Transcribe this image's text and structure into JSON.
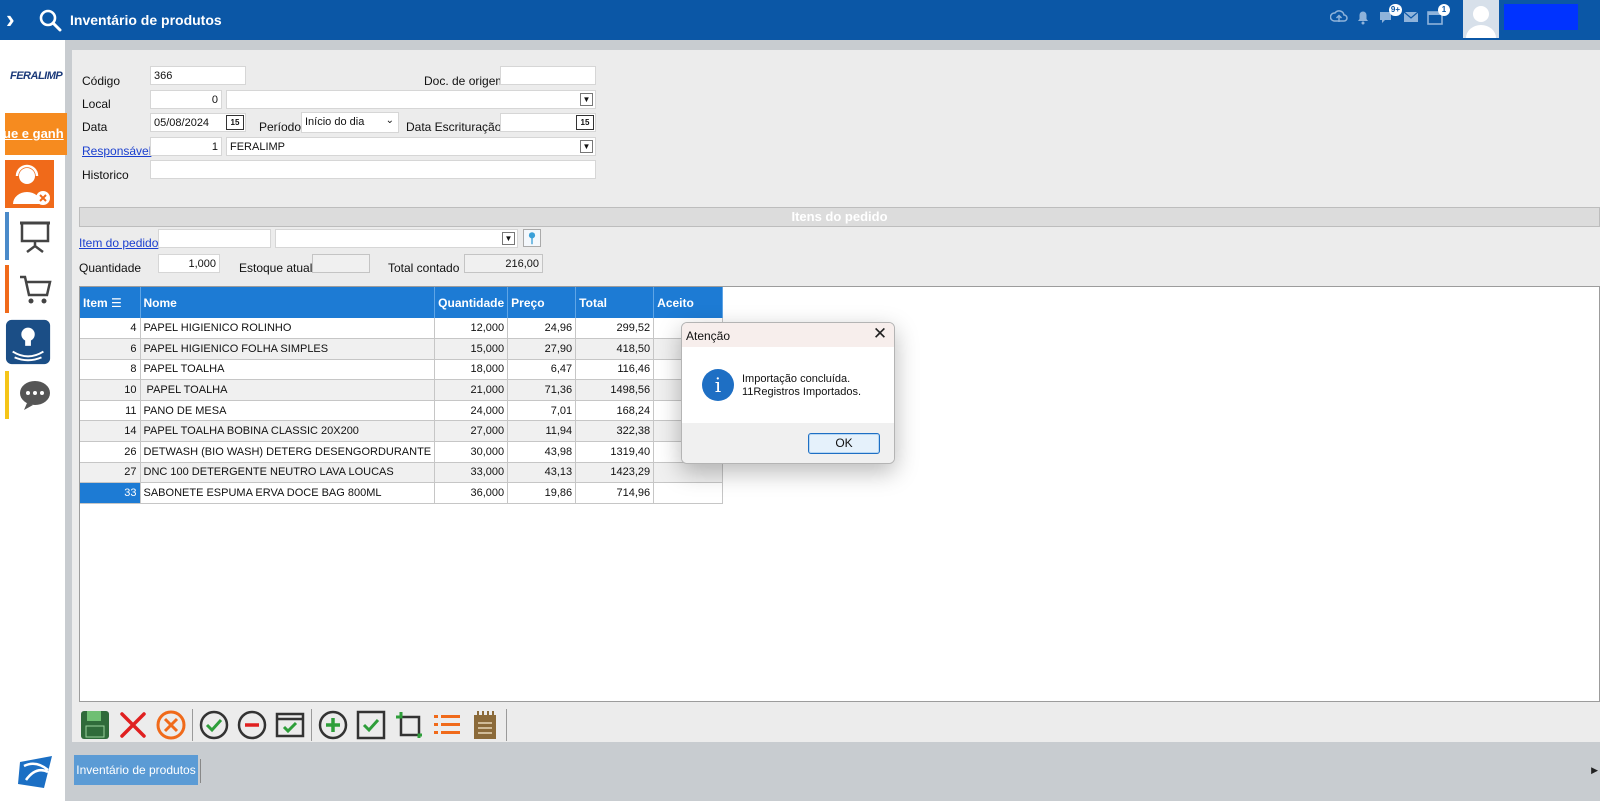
{
  "window": {
    "title": "Inventário de produtos"
  },
  "topbar": {
    "notifications_badge": "9+",
    "calendar_badge": "1"
  },
  "sidebar": {
    "logo_text": "FERALIMP",
    "promo_text": "ue e ganh"
  },
  "form": {
    "codigo": {
      "label": "Código",
      "value": "366"
    },
    "doc_origem": {
      "label": "Doc. de origem",
      "value": ""
    },
    "local": {
      "label": "Local",
      "value": "0",
      "name": ""
    },
    "data": {
      "label": "Data",
      "value": "05/08/2024"
    },
    "periodo": {
      "label": "Período",
      "value": "Início do dia"
    },
    "data_escrituracao": {
      "label": "Data Escrituração",
      "value": ""
    },
    "responsavel": {
      "label": "Responsável",
      "value": "1",
      "name": "FERALIMP"
    },
    "historico": {
      "label": "Historico",
      "value": ""
    },
    "calendar_glyph": "15"
  },
  "section": {
    "title": "Itens do pedido"
  },
  "item_form": {
    "item_label": "Item do pedido",
    "item_value": "",
    "item_desc": "",
    "quantidade_label": "Quantidade",
    "quantidade_value": "1,000",
    "estoque_label": "Estoque atual",
    "estoque_value": "",
    "total_contado_label": "Total contado",
    "total_contado_value": "216,00"
  },
  "grid": {
    "columns": [
      "Item",
      "Nome",
      "Quantidade",
      "Preço",
      "Total",
      "Aceito"
    ],
    "rows": [
      [
        "4",
        "PAPEL HIGIENICO ROLINHO",
        "12,000",
        "24,96",
        "299,52",
        ""
      ],
      [
        "6",
        "PAPEL HIGIENICO FOLHA SIMPLES",
        "15,000",
        "27,90",
        "418,50",
        ""
      ],
      [
        "8",
        "PAPEL TOALHA",
        "18,000",
        "6,47",
        "116,46",
        ""
      ],
      [
        "10",
        " PAPEL TOALHA",
        "21,000",
        "71,36",
        "1498,56",
        ""
      ],
      [
        "11",
        "PANO DE MESA",
        "24,000",
        "7,01",
        "168,24",
        ""
      ],
      [
        "14",
        "PAPEL TOALHA BOBINA CLASSIC 20X200",
        "27,000",
        "11,94",
        "322,38",
        ""
      ],
      [
        "26",
        "DETWASH (BIO WASH) DETERG DESENGORDURANTE",
        "30,000",
        "43,98",
        "1319,40",
        ""
      ],
      [
        "27",
        "DNC 100 DETERGENTE NEUTRO LAVA LOUCAS",
        "33,000",
        "43,13",
        "1423,29",
        ""
      ],
      [
        "33",
        "SABONETE ESPUMA ERVA DOCE BAG 800ML",
        "36,000",
        "19,86",
        "714,96",
        ""
      ]
    ]
  },
  "dialog": {
    "title": "Atenção",
    "line1": "Importação concluída.",
    "line2": "11Registros Importados.",
    "ok_label": "OK",
    "info_glyph": "i"
  },
  "taskbar": {
    "tab_label": "Inventário de produtos"
  }
}
